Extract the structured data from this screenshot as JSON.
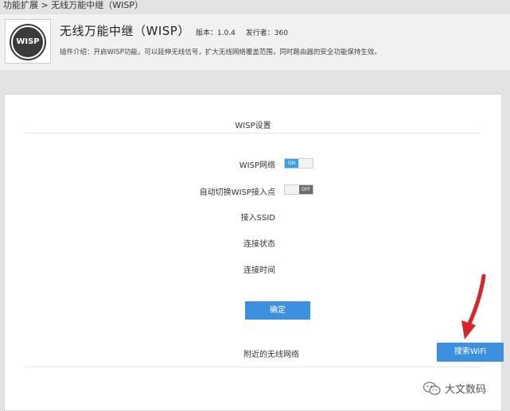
{
  "breadcrumb": "功能扩展 > 无线万能中继（WISP）",
  "plugin": {
    "logo_text": "WISP",
    "title": "无线万能中继（WISP）",
    "version": "版本：1.0.4",
    "publisher": "发行者：360",
    "description": "插件介绍：开启WISP功能，可以延伸无线信号，扩大无线网络覆盖范围，同时路由器的安全功能保持生效。"
  },
  "settings": {
    "section_title": "WISP设置",
    "wisp_network_label": "WISP网络",
    "wisp_network_state": "ON",
    "auto_switch_label": "自动切换WISP接入点",
    "auto_switch_state": "OFF",
    "ssid_label": "接入SSID",
    "status_label": "连接状态",
    "time_label": "连接时间",
    "confirm_button": "确定",
    "nearby_label": "附近的无线网络",
    "search_button": "搜索WiFi"
  },
  "watermark": "大文数码",
  "colors": {
    "accent": "#3d8fe0",
    "arrow": "#d9252a"
  }
}
